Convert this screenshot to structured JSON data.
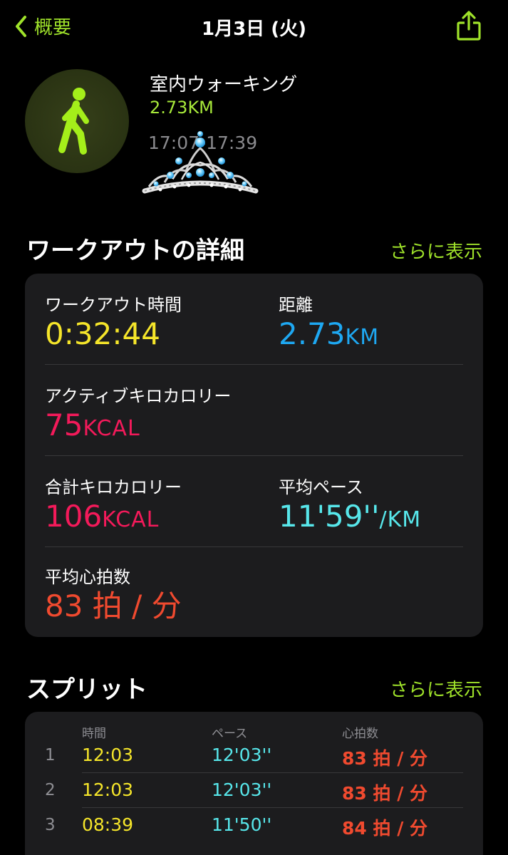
{
  "nav": {
    "back_label": "概要",
    "title": "1月3日 (火)"
  },
  "workout": {
    "name": "室内ウォーキング",
    "distance": "2.73KM",
    "time_range": "17:07-17:39"
  },
  "details": {
    "section_title": "ワークアウトの詳細",
    "more_label": "さらに表示",
    "duration": {
      "label": "ワークアウト時間",
      "value": "0:32:44"
    },
    "distance": {
      "label": "距離",
      "value": "2.73",
      "unit": "KM"
    },
    "active_kcal": {
      "label": "アクティブキロカロリー",
      "value": "75",
      "unit": "KCAL"
    },
    "total_kcal": {
      "label": "合計キロカロリー",
      "value": "106",
      "unit": "KCAL"
    },
    "avg_pace": {
      "label": "平均ペース",
      "value": "11'59''",
      "unit": "/KM"
    },
    "avg_hr": {
      "label": "平均心拍数",
      "value": "83 拍 / 分"
    }
  },
  "splits": {
    "section_title": "スプリット",
    "more_label": "さらに表示",
    "headers": {
      "time": "時間",
      "pace": "ペース",
      "hr": "心拍数"
    },
    "rows": [
      {
        "index": "1",
        "time": "12:03",
        "pace": "12'03''",
        "hr": "83 拍 / 分"
      },
      {
        "index": "2",
        "time": "12:03",
        "pace": "12'03''",
        "hr": "83 拍 / 分"
      },
      {
        "index": "3",
        "time": "08:39",
        "pace": "11'50''",
        "hr": "84 拍 / 分"
      }
    ]
  },
  "colors": {
    "accent_green": "#9fe22a",
    "duration_yellow": "#f5e52a",
    "distance_blue": "#1ea8f2",
    "calorie_pink": "#f31a5a",
    "pace_cyan": "#57e6ea",
    "hr_red": "#f04a2f"
  },
  "icons": {
    "back": "chevron-left-icon",
    "share": "share-icon",
    "activity": "walking-figure-icon",
    "sticker": "tiara-sticker"
  }
}
